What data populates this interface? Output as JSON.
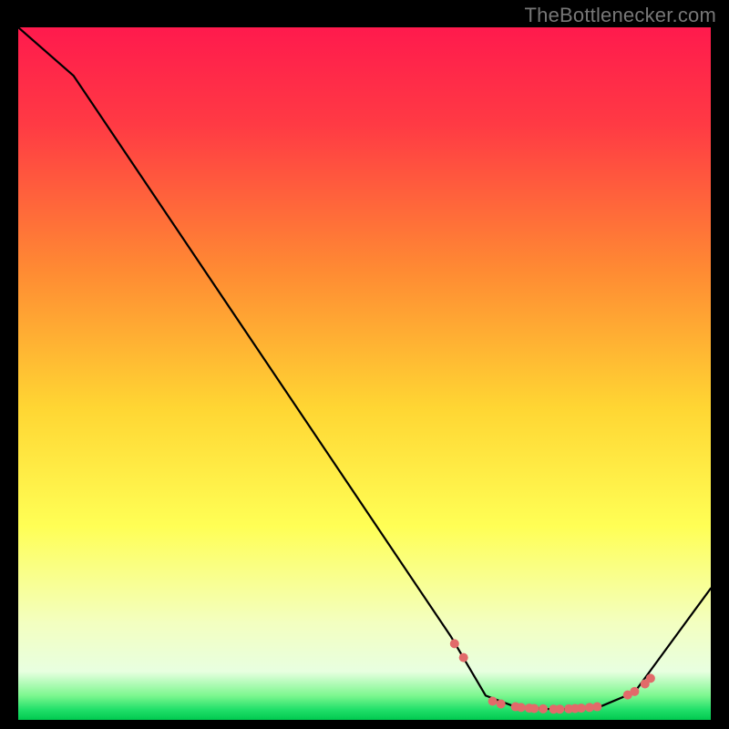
{
  "watermark": "TheBottlenecker.com",
  "chart_data": {
    "type": "line",
    "xlim": [
      0,
      100
    ],
    "ylim": [
      0,
      100
    ],
    "title": "",
    "xlabel": "",
    "ylabel": "",
    "gradient_stops": [
      {
        "offset": 0.0,
        "color": "#ff1a4d"
      },
      {
        "offset": 0.14,
        "color": "#ff3a44"
      },
      {
        "offset": 0.35,
        "color": "#ff8a33"
      },
      {
        "offset": 0.55,
        "color": "#ffd633"
      },
      {
        "offset": 0.72,
        "color": "#ffff55"
      },
      {
        "offset": 0.86,
        "color": "#f3ffc0"
      },
      {
        "offset": 0.93,
        "color": "#e8ffe0"
      },
      {
        "offset": 0.965,
        "color": "#7cf78f"
      },
      {
        "offset": 0.985,
        "color": "#22e06a"
      },
      {
        "offset": 1.0,
        "color": "#00c94f"
      }
    ],
    "series": [
      {
        "name": "curve",
        "points": [
          {
            "x": 0.0,
            "y": 100.0
          },
          {
            "x": 8.0,
            "y": 93.0
          },
          {
            "x": 62.5,
            "y": 12.0
          },
          {
            "x": 67.5,
            "y": 3.5
          },
          {
            "x": 72.0,
            "y": 1.8
          },
          {
            "x": 78.0,
            "y": 1.5
          },
          {
            "x": 84.0,
            "y": 1.9
          },
          {
            "x": 89.0,
            "y": 4.0
          },
          {
            "x": 100.0,
            "y": 19.0
          }
        ]
      }
    ],
    "markers": [
      {
        "x": 63.0,
        "y": 11.0
      },
      {
        "x": 64.3,
        "y": 9.0
      },
      {
        "x": 68.5,
        "y": 2.7
      },
      {
        "x": 69.7,
        "y": 2.3
      },
      {
        "x": 71.8,
        "y": 1.9
      },
      {
        "x": 72.6,
        "y": 1.8
      },
      {
        "x": 73.8,
        "y": 1.7
      },
      {
        "x": 74.5,
        "y": 1.65
      },
      {
        "x": 75.8,
        "y": 1.6
      },
      {
        "x": 77.3,
        "y": 1.55
      },
      {
        "x": 78.2,
        "y": 1.55
      },
      {
        "x": 79.5,
        "y": 1.6
      },
      {
        "x": 80.4,
        "y": 1.65
      },
      {
        "x": 81.3,
        "y": 1.7
      },
      {
        "x": 82.5,
        "y": 1.8
      },
      {
        "x": 83.6,
        "y": 1.9
      },
      {
        "x": 88.0,
        "y": 3.6
      },
      {
        "x": 89.0,
        "y": 4.1
      },
      {
        "x": 90.5,
        "y": 5.2
      },
      {
        "x": 91.3,
        "y": 6.0
      }
    ],
    "marker_color": "#e26a6a",
    "marker_radius": 5,
    "curve_color": "#000000",
    "curve_width": 2.2
  }
}
